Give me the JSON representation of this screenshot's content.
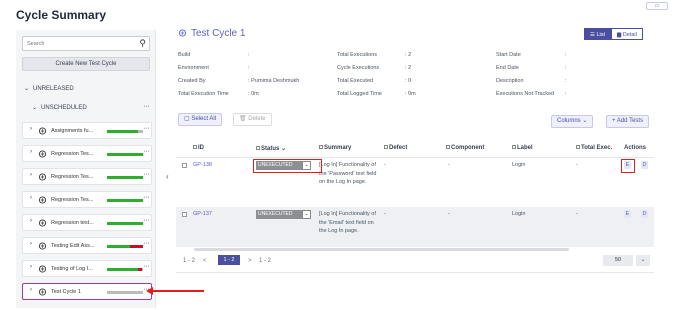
{
  "page_title": "Cycle Summary",
  "tree": {
    "search_placeholder": "Search",
    "create_button": "Create New Test Cycle",
    "unreleased_label": "UNRELEASED",
    "unscheduled_label": "UNSCHEDULED",
    "items": [
      {
        "label": "Assignments fu...",
        "progress": {
          "pass": 0.85,
          "fail": 0,
          "wip": 0
        },
        "selected": false
      },
      {
        "label": "Regression Tes...",
        "progress": {
          "pass": 1.0,
          "fail": 0,
          "wip": 0
        },
        "selected": false
      },
      {
        "label": "Regression Tes...",
        "progress": {
          "pass": 1.0,
          "fail": 0,
          "wip": 0
        },
        "selected": false
      },
      {
        "label": "Regression Tes...",
        "progress": {
          "pass": 1.0,
          "fail": 0,
          "wip": 0
        },
        "selected": false
      },
      {
        "label": "Regression test...",
        "progress": {
          "pass": 1.0,
          "fail": 0,
          "wip": 0
        },
        "selected": false
      },
      {
        "label": "Testing Edit Ass...",
        "progress": {
          "pass": 0.65,
          "fail": 0.35,
          "wip": 0
        },
        "selected": false
      },
      {
        "label": "Testing of Log I...",
        "progress": {
          "pass": 0.85,
          "fail": 0.12,
          "wip": 0.03
        },
        "selected": false
      },
      {
        "label": "Test Cycle 1",
        "progress": {
          "pass": 0,
          "fail": 0,
          "wip": 0
        },
        "selected": true
      }
    ],
    "colors": {
      "pass": "#2eae2e",
      "fail": "#c8102e",
      "unexecuted": "#bbbbbb"
    }
  },
  "main": {
    "title": "Test Cycle 1",
    "view_list": "List",
    "view_detail": "Detail",
    "meta": {
      "build_label": "Build",
      "build_value": ":",
      "environment_label": "Environment",
      "environment_value": ":",
      "created_by_label": "Created By",
      "created_by_value": "Purnima Deshmukh",
      "total_exec_time_label": "Total Execution Time",
      "total_exec_time_value": "0m",
      "total_executions_label": "Total Executions",
      "total_executions_value": "2",
      "cycle_executions_label": "Cycle Executions",
      "cycle_executions_value": "2",
      "total_executed_label": "Total Executed",
      "total_executed_value": "0",
      "total_logged_time_label": "Total Logged Time",
      "total_logged_time_value": "0m",
      "start_date_label": "Start Date",
      "start_date_value": ":",
      "end_date_label": "End Date",
      "end_date_value": ":",
      "description_label": "Description",
      "description_value": ":",
      "exec_not_tracked_label": "Executions Not Tracked",
      "exec_not_tracked_value": ":"
    },
    "toolbar": {
      "select_all": "Select All",
      "delete": "Delete",
      "columns": "Columns",
      "add_tests": "+ Add Tests"
    },
    "table": {
      "headers": {
        "id": "ID",
        "status": "Status",
        "summary": "Summary",
        "defect": "Defect",
        "component": "Component",
        "label": "Label",
        "total_exec": "Total Exec.",
        "actions": "Actions"
      },
      "rows": [
        {
          "id": "GP-138",
          "status": "UNEXECUTED",
          "summary": "[Log In] Functionality of the 'Password' text field on the Log In page.",
          "defect": "-",
          "component": "-",
          "label": "Login",
          "total_exec": "-",
          "action_e": "E",
          "action_d": "D"
        },
        {
          "id": "GP-137",
          "status": "UNEXECUTED",
          "summary": "[Log In] Functionality of the 'Email' text field on the Log In page.",
          "defect": "-",
          "component": "-",
          "label": "Login",
          "total_exec": "-",
          "action_e": "E",
          "action_d": "D"
        }
      ]
    },
    "pagination": {
      "left_text": "1 - 2",
      "prev": "<",
      "current": "1 - 2",
      "next": ">",
      "right_text": "1 - 2",
      "page_size": "50"
    }
  }
}
